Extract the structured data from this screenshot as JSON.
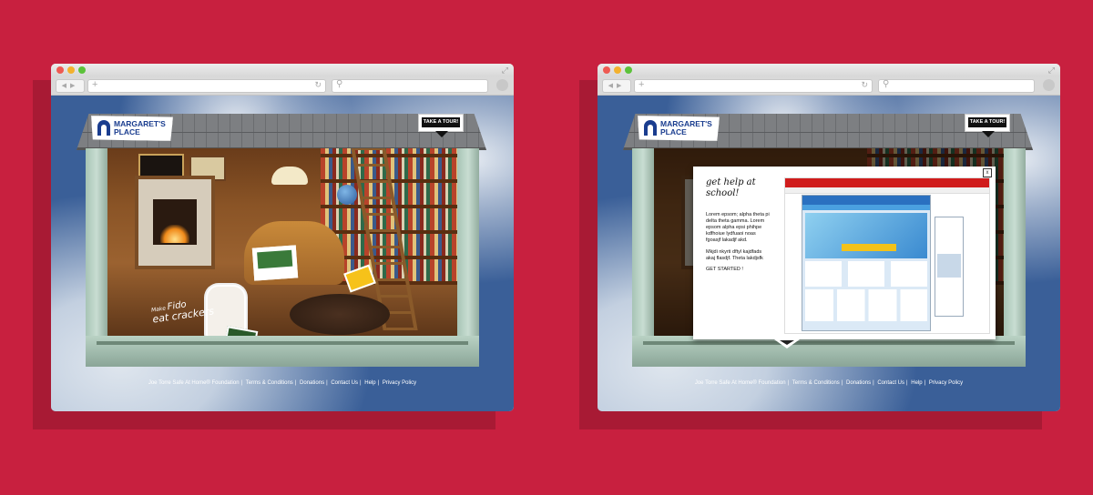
{
  "brand": {
    "logo_text": "MARGARET'S PLACE"
  },
  "tour_button": "TAKE A TOUR!",
  "scribble": {
    "small": "Make",
    "name": "Fido",
    "rest": "eat crackers"
  },
  "footer": {
    "links": [
      "Joe Torre Safe At Home® Foundation",
      "Terms & Conditions",
      "Donations",
      "Contact Us",
      "Help",
      "Privacy Policy"
    ],
    "separator": "|"
  },
  "modal": {
    "title": "get help at school!",
    "paragraph1": "Lorem epsom; alpha theta pi delta theta gamma. Lorem epsom alpha epsi phihpe kdfhoiue lydfuaoi noas fgoasjf lakadjf akd.",
    "paragraph2": "Mkjdi nkyrti dftyl kajdfads akaj flasdjf. Theta lakdjsfk",
    "cta": "GET STARTED !",
    "close": "x"
  }
}
